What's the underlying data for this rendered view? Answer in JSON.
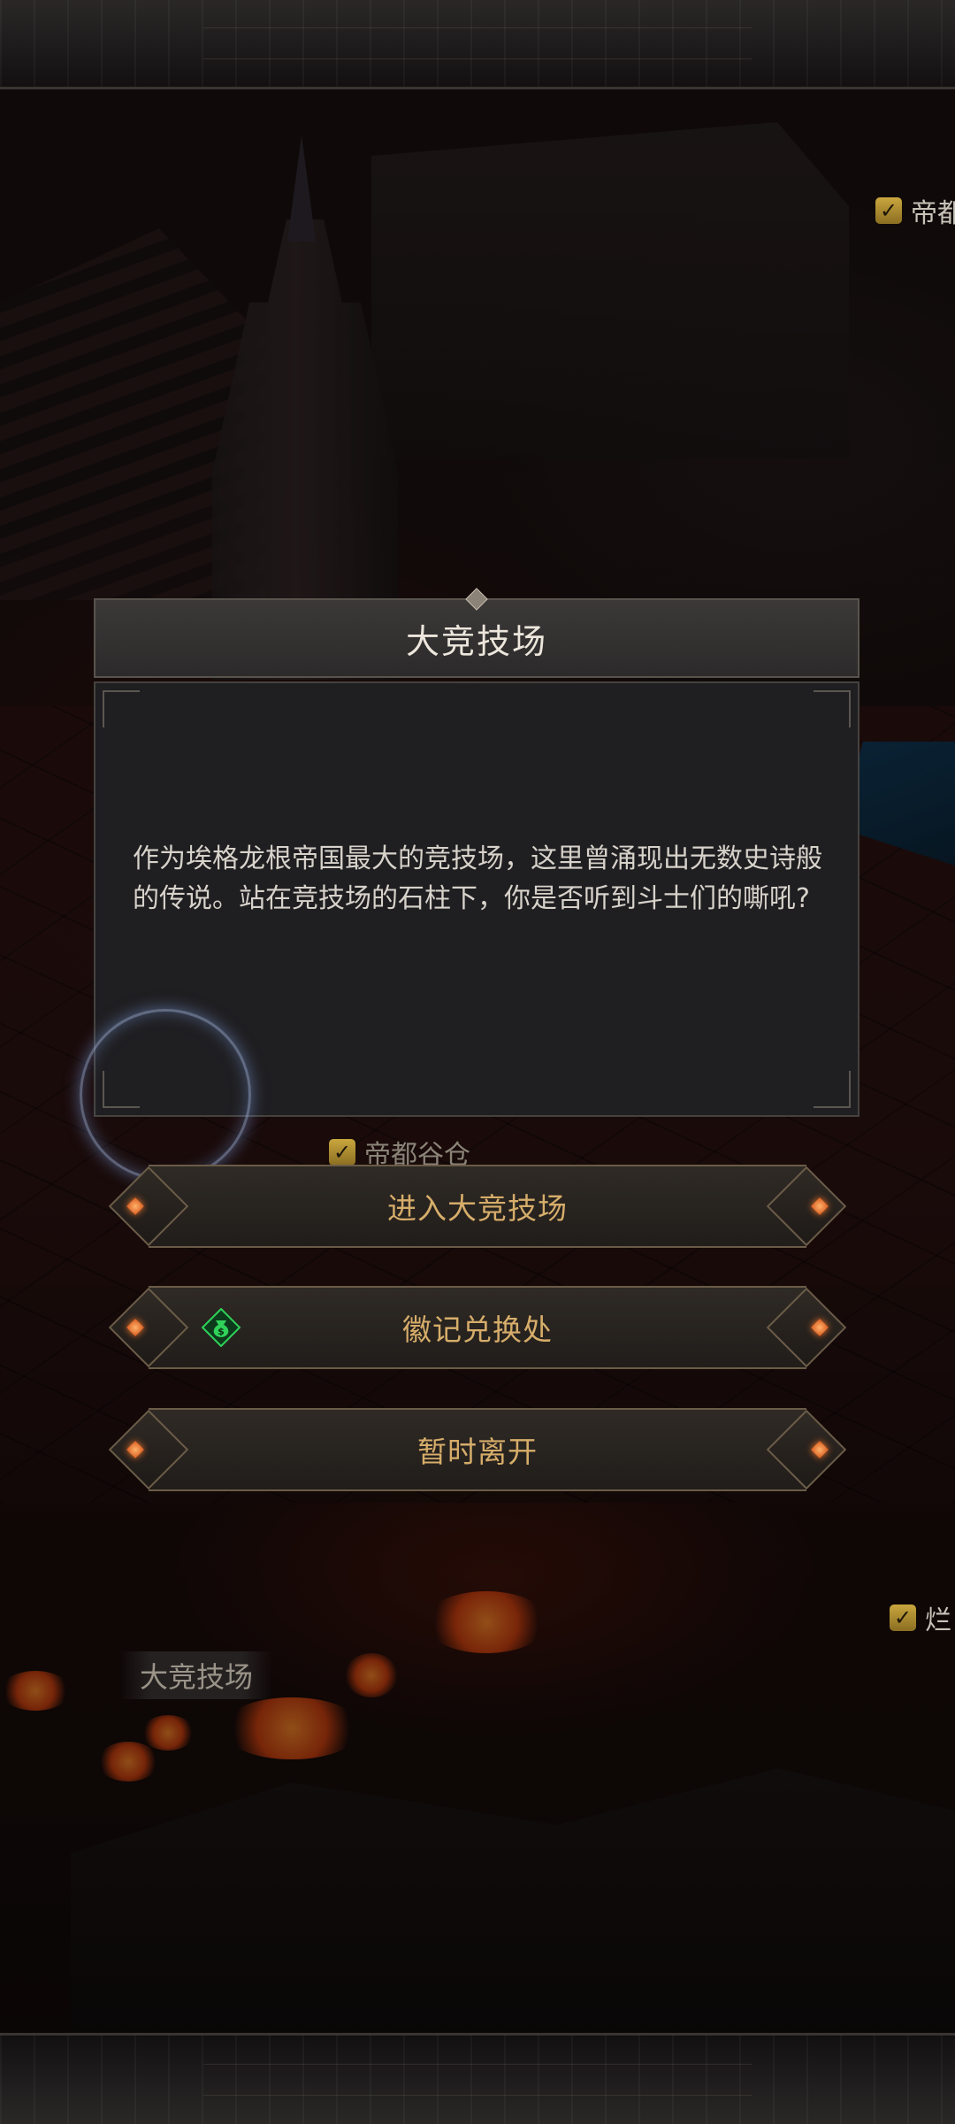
{
  "map": {
    "labels": [
      {
        "id": "top-right",
        "text": "帝都"
      },
      {
        "id": "granary",
        "text": "帝都谷仓"
      },
      {
        "id": "right-lower",
        "text": "烂"
      }
    ],
    "arena_plate": "大竞技场"
  },
  "dialog": {
    "title": "大竞技场",
    "description": "作为埃格龙根帝国最大的竞技场，这里曾涌现出无数史诗般的传说。站在竞技场的石柱下，你是否听到斗士们的嘶吼?"
  },
  "actions": [
    {
      "label": "进入大竞技场"
    },
    {
      "label": "徽记兑换处",
      "icon": "money-bag-icon"
    },
    {
      "label": "暂时离开"
    }
  ],
  "colors": {
    "button_text": "#d6ad6a",
    "check_badge": "#c9a63e",
    "money_icon": "#2fd35a"
  }
}
